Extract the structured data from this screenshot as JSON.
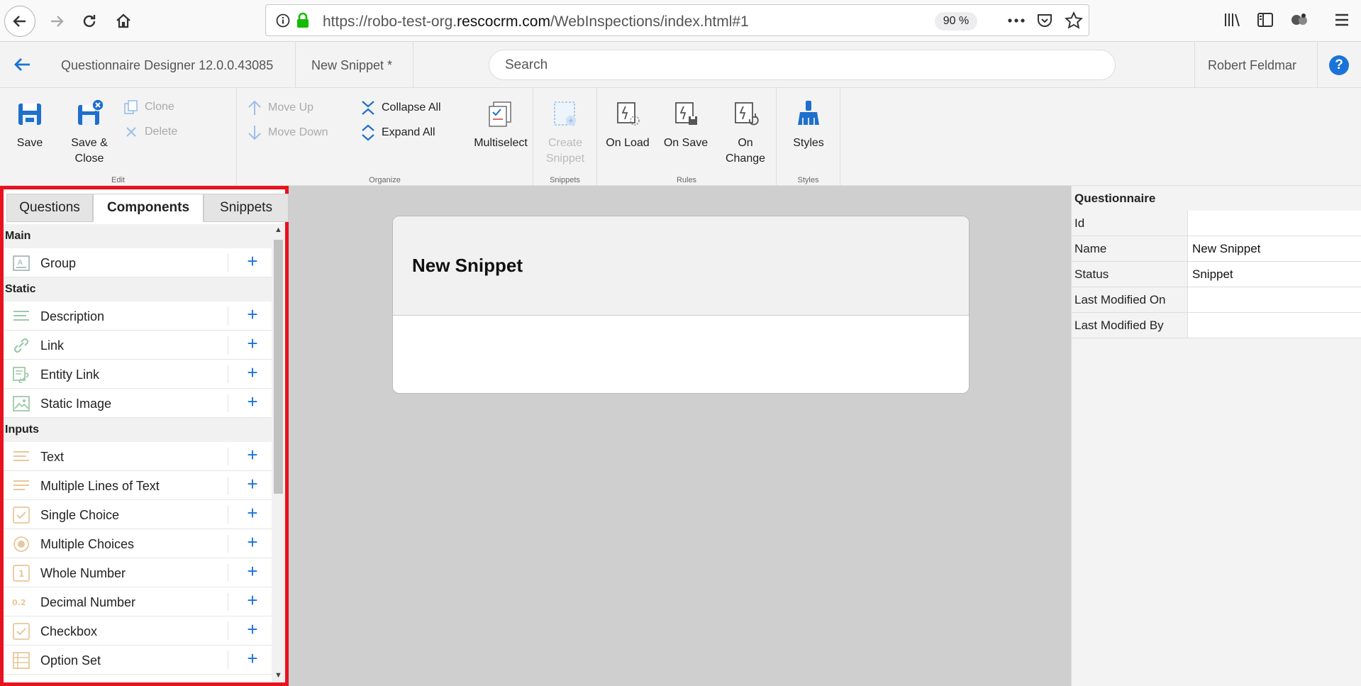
{
  "browser": {
    "url_prefix": "https://robo-test-org.",
    "url_domain": "rescocrm.com",
    "url_suffix": "/WebInspections/index.html#1",
    "zoom": "90 %"
  },
  "header": {
    "app_title": "Questionnaire Designer 12.0.0.43085",
    "document_title": "New Snippet *",
    "search_placeholder": "Search",
    "user_name": "Robert Feldmar",
    "help_label": "?"
  },
  "ribbon": {
    "edit": {
      "label": "Edit",
      "save": "Save",
      "save_close_1": "Save &",
      "save_close_2": "Close",
      "clone": "Clone",
      "delete": "Delete"
    },
    "organize": {
      "label": "Organize",
      "move_up": "Move Up",
      "move_down": "Move Down",
      "collapse_all": "Collapse All",
      "expand_all": "Expand All",
      "multiselect": "Multiselect"
    },
    "snippets": {
      "label": "Snippets",
      "create_1": "Create",
      "create_2": "Snippet"
    },
    "rules": {
      "label": "Rules",
      "on_load": "On Load",
      "on_save": "On Save",
      "on_change_1": "On",
      "on_change_2": "Change"
    },
    "styles": {
      "label": "Styles",
      "styles": "Styles"
    }
  },
  "left_panel": {
    "tabs": [
      "Questions",
      "Components",
      "Snippets"
    ],
    "sections": [
      {
        "title": "Main",
        "items": [
          {
            "label": "Group",
            "icon": "group-icon"
          }
        ]
      },
      {
        "title": "Static",
        "items": [
          {
            "label": "Description",
            "icon": "description-icon"
          },
          {
            "label": "Link",
            "icon": "link-icon"
          },
          {
            "label": "Entity Link",
            "icon": "entity-link-icon"
          },
          {
            "label": "Static Image",
            "icon": "static-image-icon"
          }
        ]
      },
      {
        "title": "Inputs",
        "items": [
          {
            "label": "Text",
            "icon": "text-icon"
          },
          {
            "label": "Multiple Lines of Text",
            "icon": "multiline-text-icon"
          },
          {
            "label": "Single Choice",
            "icon": "single-choice-icon"
          },
          {
            "label": "Multiple Choices",
            "icon": "multiple-choices-icon"
          },
          {
            "label": "Whole Number",
            "icon": "whole-number-icon"
          },
          {
            "label": "Decimal Number",
            "icon": "decimal-number-icon"
          },
          {
            "label": "Checkbox",
            "icon": "checkbox-icon"
          },
          {
            "label": "Option Set",
            "icon": "option-set-icon"
          }
        ]
      }
    ],
    "decimal_icon_text": "0.2",
    "whole_icon_text": "1"
  },
  "canvas": {
    "card_title": "New Snippet"
  },
  "properties": {
    "title": "Questionnaire",
    "rows": [
      {
        "key": "Id",
        "value": ""
      },
      {
        "key": "Name",
        "value": "New Snippet"
      },
      {
        "key": "Status",
        "value": "Snippet"
      },
      {
        "key": "Last Modified On",
        "value": ""
      },
      {
        "key": "Last Modified By",
        "value": ""
      }
    ]
  }
}
